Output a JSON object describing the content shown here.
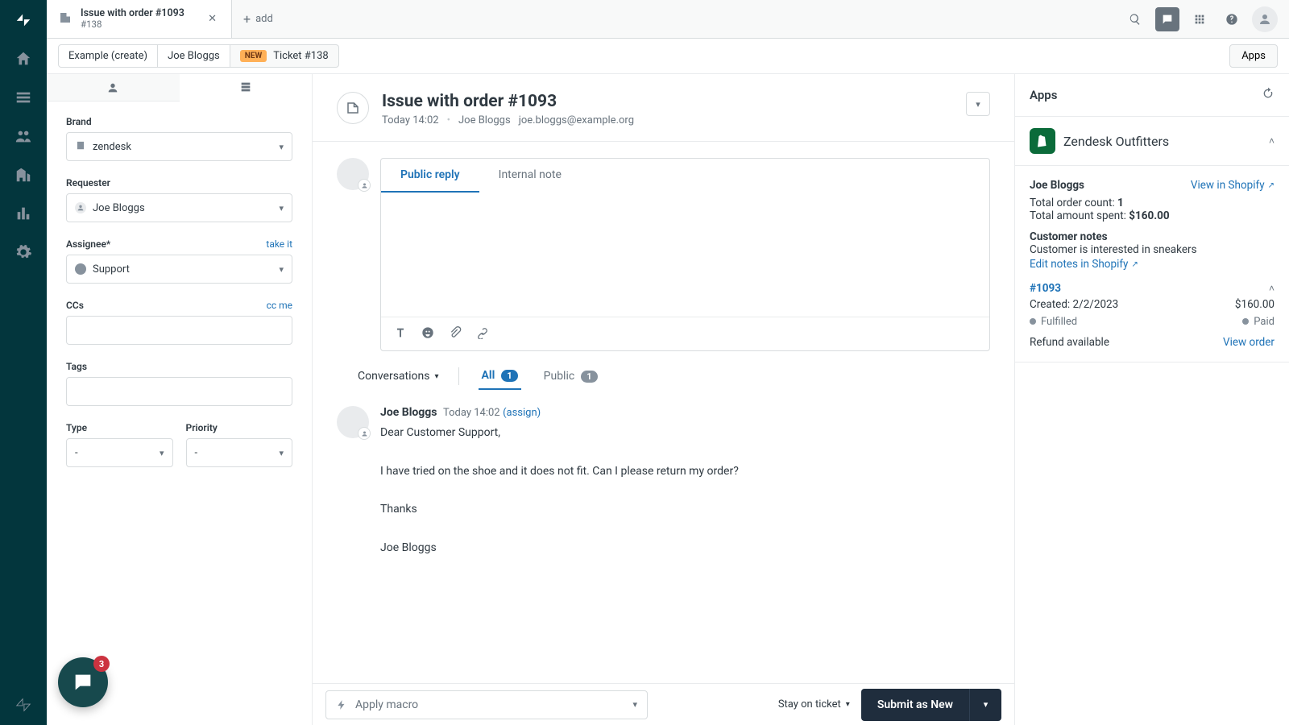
{
  "top_tab": {
    "title": "Issue with order #1093",
    "subtitle": "#138"
  },
  "add_tab_label": "add",
  "breadcrumbs": {
    "seg1": "Example (create)",
    "seg2": "Joe Bloggs",
    "badge": "New",
    "seg3": "Ticket #138"
  },
  "apps_button": "Apps",
  "form": {
    "brand_label": "Brand",
    "brand_value": "zendesk",
    "requester_label": "Requester",
    "requester_value": "Joe Bloggs",
    "assignee_label": "Assignee*",
    "take_it": "take it",
    "assignee_value": "Support",
    "ccs_label": "CCs",
    "cc_me": "cc me",
    "tags_label": "Tags",
    "type_label": "Type",
    "type_value": "-",
    "priority_label": "Priority",
    "priority_value": "-"
  },
  "chat_badge": "3",
  "ticket": {
    "title": "Issue with order #1093",
    "meta_time": "Today 14:02",
    "meta_author": "Joe Bloggs",
    "meta_email": "joe.bloggs@example.org"
  },
  "composer": {
    "tab_public": "Public reply",
    "tab_internal": "Internal note"
  },
  "conv": {
    "label": "Conversations",
    "all": "All",
    "all_count": "1",
    "public": "Public",
    "public_count": "1"
  },
  "message": {
    "author": "Joe Bloggs",
    "time": "Today 14:02",
    "assign": "(assign)",
    "body": "Dear Customer Support,\n\nI have tried on the shoe and it does not fit. Can I please return my order?\n\nThanks\n\nJoe Bloggs"
  },
  "apps_panel": {
    "title": "Apps",
    "app_name": "Zendesk Outfitters",
    "customer_name": "Joe Bloggs",
    "view_in_shopify": "View in Shopify",
    "total_order_count_label": "Total order count: ",
    "total_order_count": "1",
    "total_amount_label": "Total amount spent: ",
    "total_amount": "$160.00",
    "customer_notes_label": "Customer notes",
    "customer_notes": "Customer is interested in sneakers",
    "edit_notes": "Edit notes in Shopify",
    "order_id": "#1093",
    "order_created_label": "Created: ",
    "order_created": "2/2/2023",
    "order_amount": "$160.00",
    "fulfilled": "Fulfilled",
    "paid": "Paid",
    "refund": "Refund available",
    "view_order": "View order"
  },
  "footer": {
    "macro": "Apply macro",
    "stay": "Stay on ticket",
    "submit": "Submit as New"
  }
}
